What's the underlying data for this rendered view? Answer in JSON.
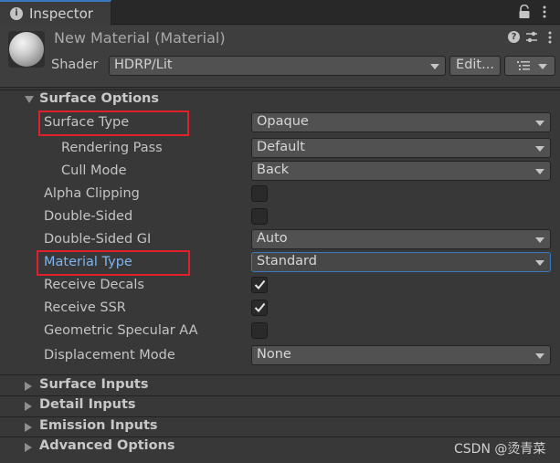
{
  "tab": {
    "label": "Inspector"
  },
  "header": {
    "title": "New Material (Material)",
    "shader_label": "Shader",
    "shader_value": "HDRP/Lit",
    "edit_label": "Edit..."
  },
  "surface_options": {
    "title": "Surface Options",
    "rows": {
      "surface_type": {
        "label": "Surface Type",
        "value": "Opaque"
      },
      "rendering_pass": {
        "label": "Rendering Pass",
        "value": "Default"
      },
      "cull_mode": {
        "label": "Cull Mode",
        "value": "Back"
      },
      "alpha_clipping": {
        "label": "Alpha Clipping",
        "checked": false
      },
      "double_sided": {
        "label": "Double-Sided",
        "checked": false
      },
      "double_sided_gi": {
        "label": "Double-Sided GI",
        "value": "Auto"
      },
      "material_type": {
        "label": "Material Type",
        "value": "Standard"
      },
      "receive_decals": {
        "label": "Receive Decals",
        "checked": true
      },
      "receive_ssr": {
        "label": "Receive SSR",
        "checked": true
      },
      "geometric_specular_aa": {
        "label": "Geometric Specular AA",
        "checked": false
      },
      "displacement_mode": {
        "label": "Displacement Mode",
        "value": "None"
      }
    }
  },
  "collapsed_sections": {
    "surface_inputs": "Surface Inputs",
    "detail_inputs": "Detail Inputs",
    "emission_inputs": "Emission Inputs",
    "advanced_options": "Advanced Options"
  },
  "watermark": "CSDN @烫青菜",
  "colors": {
    "background": "#383838",
    "highlight_box": "#e0202a",
    "focus_blue": "#3a79bb",
    "label_blue": "#7eb4ee"
  }
}
